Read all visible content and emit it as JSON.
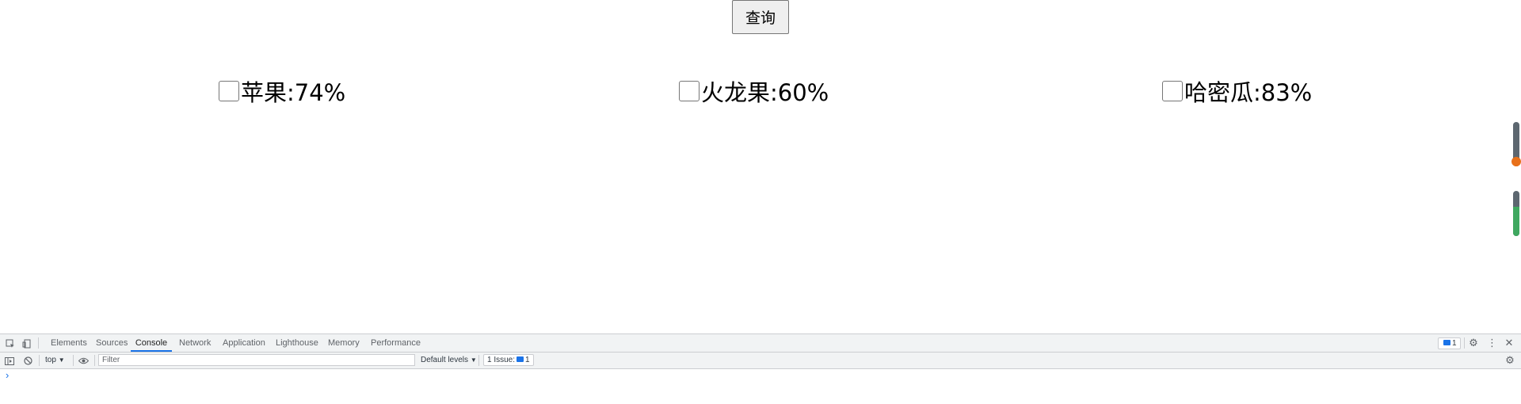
{
  "page": {
    "query_button": "查询",
    "fruits": [
      {
        "label": "苹果:74%",
        "percent": 74
      },
      {
        "label": "火龙果:60%",
        "percent": 60
      },
      {
        "label": "哈密瓜:83%",
        "percent": 83
      }
    ],
    "gauges": [
      {
        "fill_fraction": 0.05,
        "fill_color": "#e8711a"
      },
      {
        "fill_fraction": 0.65,
        "fill_color": "#3fa860"
      }
    ]
  },
  "devtools": {
    "tabs": [
      "Elements",
      "Sources",
      "Console",
      "Network",
      "Application",
      "Lighthouse",
      "Memory",
      "Performance"
    ],
    "active_tab": "Console",
    "messages_count": "1",
    "context_select": "top",
    "filter_placeholder": "Filter",
    "levels_select": "Default levels",
    "issues_label": "1 Issue:",
    "issues_count": "1",
    "prompt_symbol": "›"
  },
  "colors": {
    "accent": "#1a73e8",
    "gauge_track": "#5d6770"
  }
}
